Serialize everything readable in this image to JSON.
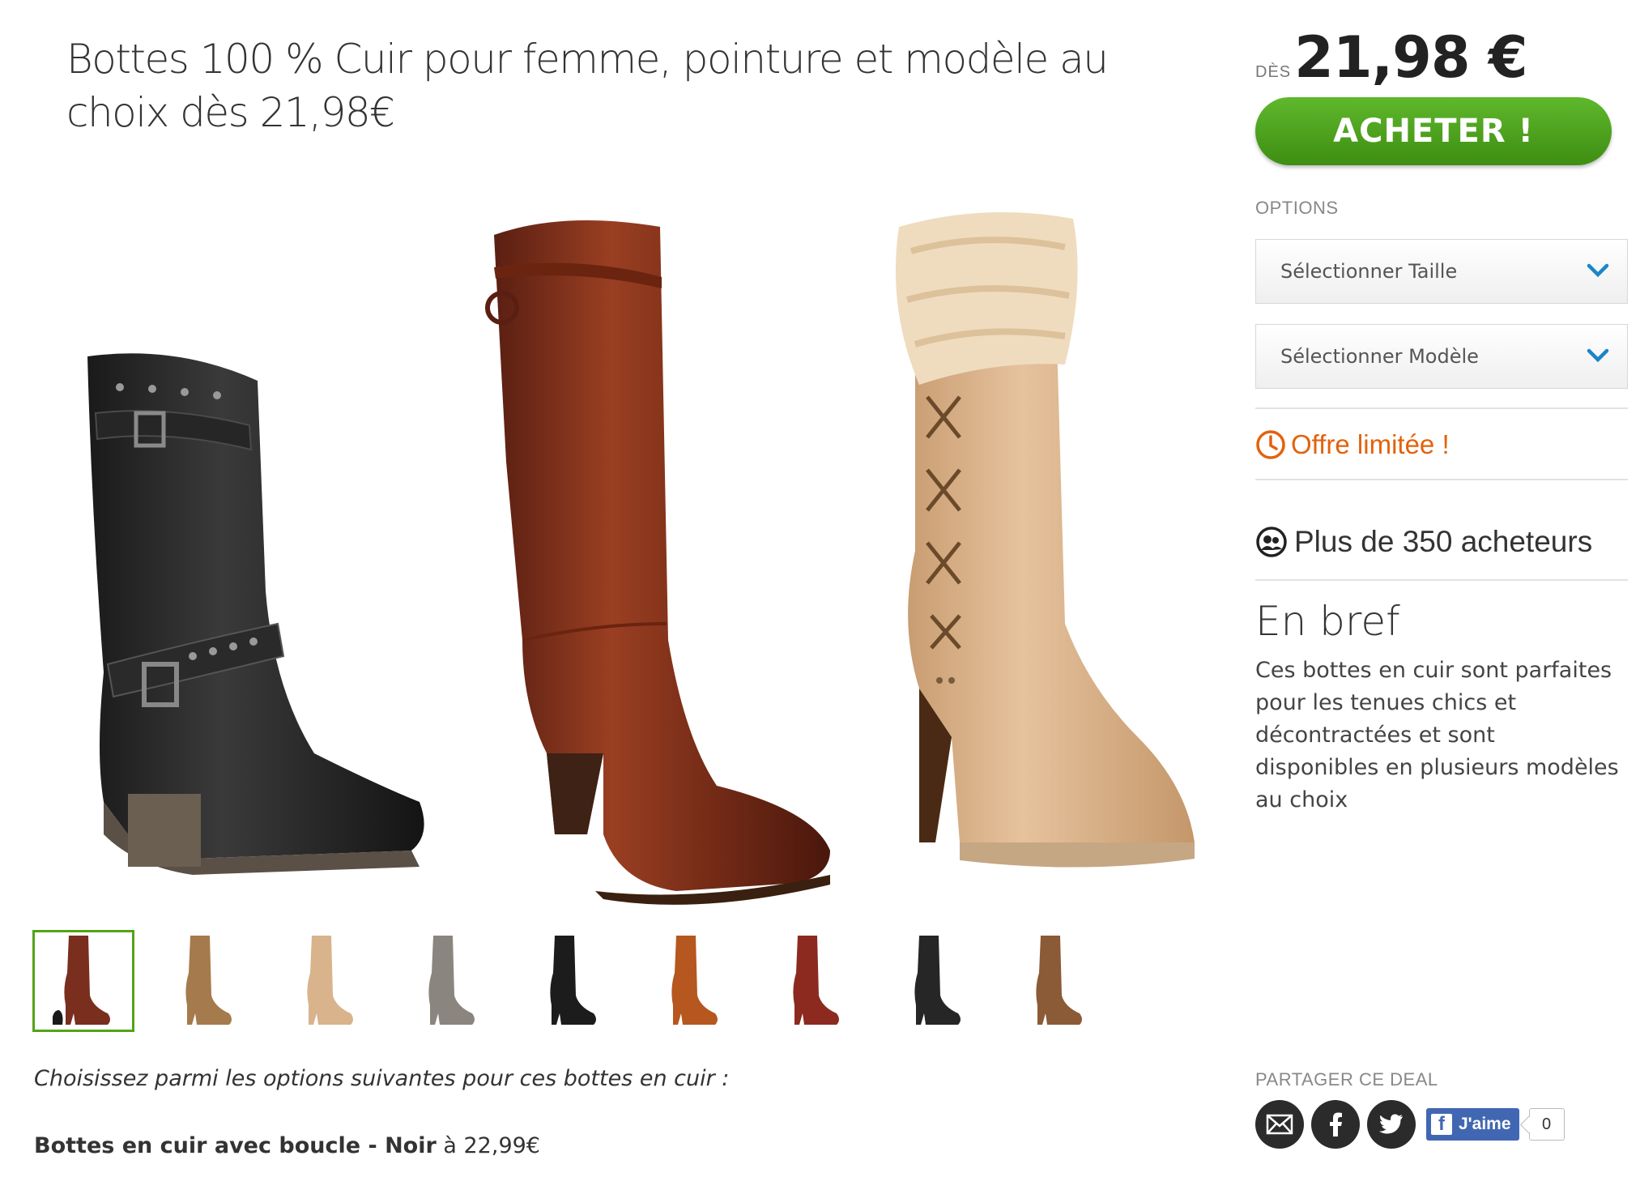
{
  "deal": {
    "title": "Bottes 100 % Cuir pour femme, pointure et modèle au choix dès 21,98€",
    "price_prefix": "DÈS",
    "price": "21,98 €",
    "buy_label": "ACHETER !"
  },
  "options": {
    "label": "OPTIONS",
    "size_select": "Sélectionner Taille",
    "model_select": "Sélectionner Modèle"
  },
  "offer": {
    "label": "Offre limitée !"
  },
  "buyers": {
    "label": "Plus de 350 acheteurs"
  },
  "summary": {
    "title": "En bref",
    "text": "Ces bottes en cuir sont parfaites pour les tenues chics et décontractées et sont disponibles en plusieurs modèles au choix"
  },
  "description": {
    "intro": "Choisissez parmi les options suivantes pour ces bottes en cuir :",
    "first_option_name": "Bottes en cuir avec boucle - Noir",
    "first_option_price": " à 22,99€"
  },
  "share": {
    "label": "PARTAGER CE DEAL",
    "like_label": "J'aime",
    "like_count": "0"
  },
  "gallery": {
    "main_images": [
      "black-buckle-boot",
      "brown-leather-boot",
      "beige-fur-boot"
    ],
    "thumbnails": [
      {
        "name": "brown-leather-boot-group",
        "color": "#7a2e1e"
      },
      {
        "name": "tan-suede-boot",
        "color": "#a57a4c"
      },
      {
        "name": "beige-fur-boot",
        "color": "#d9b38c"
      },
      {
        "name": "grey-suede-boot",
        "color": "#8a857e"
      },
      {
        "name": "black-fringe-boot",
        "color": "#1c1c1c"
      },
      {
        "name": "cognac-suede-boot",
        "color": "#b5571e"
      },
      {
        "name": "red-leather-boot",
        "color": "#8c2a20"
      },
      {
        "name": "black-buckle-boot",
        "color": "#262626"
      },
      {
        "name": "brown-buckle-boot",
        "color": "#8b5a36"
      }
    ]
  },
  "colors": {
    "accent_green": "#53a318",
    "offer_orange": "#e2620c",
    "facebook_blue": "#4267b2"
  }
}
